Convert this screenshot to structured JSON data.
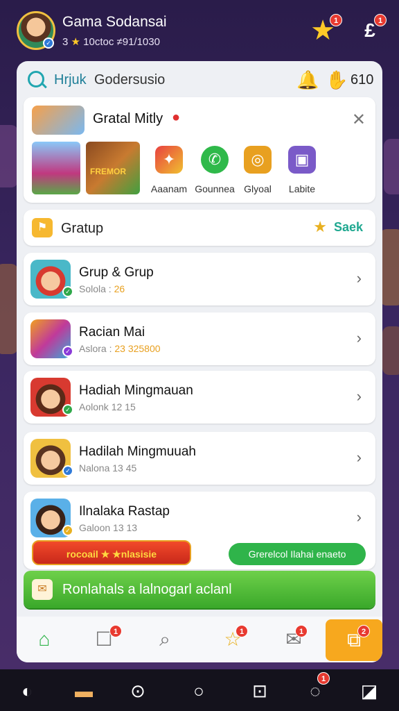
{
  "header": {
    "user_name": "Gama Sodansai",
    "user_sub_prefix": "3",
    "user_sub_suffix": "10ctoc ≠91/1030",
    "star_badge": "1",
    "coin_badge": "1"
  },
  "search": {
    "query_highlight": "Hrjuk",
    "query_rest": "Godersusio",
    "coin_count": "610"
  },
  "promo": {
    "title": "Gratal Mitly",
    "tile_text": "FREMOR",
    "apps": [
      "Aaanam",
      "Gounnea",
      "Glyoal",
      "Labite"
    ]
  },
  "group_header": {
    "title": "Gratup",
    "see_all": "Saek"
  },
  "rows": [
    {
      "title": "Grup & Grup",
      "sub_label": "Solola :",
      "sub_value": "26"
    },
    {
      "title": "Racian Mai",
      "sub_label": "Aslora :",
      "sub_value": "23 325800"
    },
    {
      "title": "Hadiah Mingmauan",
      "sub_label": "Aolonk 12 15",
      "sub_value": ""
    },
    {
      "title": "Hadilah Mingmuuah",
      "sub_label": "Nalona 13 45",
      "sub_value": ""
    },
    {
      "title": "Ilnalaka Rastap",
      "sub_label": "Galoon 13 13",
      "sub_value": ""
    }
  ],
  "row5_buttons": {
    "red_pill": "rocoail ★ ★nlasisie",
    "green_pill": "Grerelcol Ilahai enaeto"
  },
  "banner": {
    "text": "Ronlahals a lalnogarl aclanl"
  },
  "tab_badges": {
    "chat": "1",
    "star": "1",
    "mail": "1",
    "active": "2"
  },
  "system_badge": "1",
  "colors": {
    "accent_green": "#2fb44a",
    "accent_orange": "#f7a81e",
    "accent_teal": "#21a6b0",
    "badge_red": "#e83a30",
    "background_purple": "#3a2660"
  }
}
